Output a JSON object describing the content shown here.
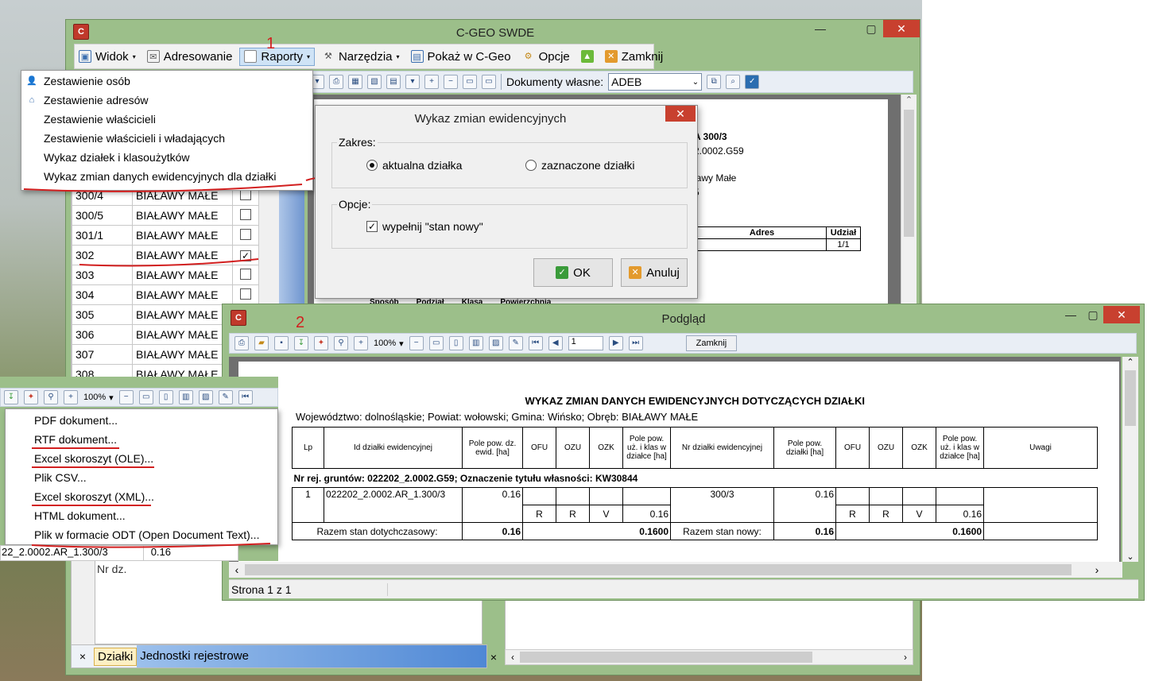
{
  "main_window": {
    "title": "C-GEO SWDE",
    "icon_text": "C",
    "menu": [
      {
        "label": "Widok"
      },
      {
        "label": "Adresowanie"
      },
      {
        "label": "Raporty"
      },
      {
        "label": "Narzędzia"
      },
      {
        "label": "Pokaż w C-Geo"
      },
      {
        "label": "Opcje"
      },
      {
        "label": "Zamknij"
      }
    ],
    "toolbar": {
      "own_docs_label": "Dokumenty własne:",
      "own_docs_value": "ADEB"
    },
    "annotation_1": "1",
    "annotation_2": "2"
  },
  "raporty_menu": {
    "items": [
      {
        "label": "Zestawienie osób"
      },
      {
        "label": "Zestawienie adresów"
      },
      {
        "label": "Zestawienie właścicieli"
      },
      {
        "label": "Zestawienie właścicieli i władających"
      },
      {
        "label": "Wykaz działek i klasoużytków"
      },
      {
        "label": "Wykaz zmian danych ewidencyjnych dla działki"
      }
    ]
  },
  "parcel_list": {
    "rows": [
      {
        "id": "300/4",
        "obreb": "BIAŁAWY MAŁE",
        "checked": false
      },
      {
        "id": "300/5",
        "obreb": "BIAŁAWY MAŁE",
        "checked": false
      },
      {
        "id": "301/1",
        "obreb": "BIAŁAWY MAŁE",
        "checked": false
      },
      {
        "id": "302",
        "obreb": "BIAŁAWY MAŁE",
        "checked": true
      },
      {
        "id": "303",
        "obreb": "BIAŁAWY MAŁE",
        "checked": false
      },
      {
        "id": "304",
        "obreb": "BIAŁAWY MAŁE",
        "checked": false
      },
      {
        "id": "305",
        "obreb": "BIAŁAWY MAŁE",
        "checked": false
      },
      {
        "id": "306",
        "obreb": "BIAŁAWY MAŁE",
        "checked": false
      },
      {
        "id": "307",
        "obreb": "BIAŁAWY MAŁE",
        "checked": false
      },
      {
        "id": "308",
        "obreb": "BIAŁAWY MAŁE",
        "checked": false
      }
    ],
    "lower_cell_1": "22_2.0002.AR_1.300/3",
    "lower_cell_2": "0.16",
    "nr_dz_label": "Nr dz.",
    "tabs": [
      {
        "label": "Działki"
      },
      {
        "label": "Jednostki rejestrowe"
      }
    ],
    "close_glyph": "×"
  },
  "bg_doc": {
    "line1": "A 300/3",
    "line2": "2.0002.G59",
    "line3": "ławy Małe",
    "line4": "5",
    "col_adres": "Adres",
    "col_udzial": "Udział",
    "udzial_val": "1/1",
    "bottom_cols": [
      "Sposób",
      "Podział",
      "Klasa",
      "Powierzchnia"
    ]
  },
  "dialog": {
    "title": "Wykaz zmian ewidencyjnych",
    "zakres_label": "Zakres:",
    "opt_current": "aktualna działka",
    "opt_selected": "zaznaczone działki",
    "opcje_label": "Opcje:",
    "checkbox_label": "wypełnij \"stan nowy\"",
    "ok_label": "OK",
    "cancel_label": "Anuluj"
  },
  "preview": {
    "title": "Podgląd",
    "zoom": "100%",
    "page": "1",
    "close_label": "Zamknij",
    "status": "Strona 1 z 1",
    "report": {
      "title": "WYKAZ ZMIAN DANYCH EWIDENCYJNYCH DOTYCZĄCYCH DZIAŁKI",
      "subtitle": "Województwo: dolnośląskie; Powiat: wołowski; Gmina: Wińsko; Obręb: BIAŁAWY MAŁE",
      "headers": [
        "Lp",
        "Id działki ewidencyjnej",
        "Pole pow. dz. ewid. [ha]",
        "OFU",
        "OZU",
        "OZK",
        "Pole pow. uż. i klas w działce [ha]",
        "Nr działki ewidencyjnej",
        "Pole pow. działki [ha]",
        "OFU",
        "OZU",
        "OZK",
        "Pole pow. uż. i klas w działce [ha]",
        "Uwagi"
      ],
      "group_line": "Nr rej. gruntów: 022202_2.0002.G59;   Oznaczenie tytułu własności: KW30844",
      "row": {
        "lp": "1",
        "id": "022202_2.0002.AR_1.300/3",
        "area": "0.16",
        "ofu": "R",
        "ozu": "R",
        "ozk": "V",
        "area_klas": "0.16",
        "nr": "300/3",
        "new_area": "0.16",
        "new_ofu": "R",
        "new_ozu": "R",
        "new_ozk": "V",
        "new_area_klas": "0.16"
      },
      "total_old_label": "Razem stan dotychczasowy:",
      "total_old_area": "0.16",
      "total_old_klas": "0.1600",
      "total_new_label": "Razem stan nowy:",
      "total_new_area": "0.16",
      "total_new_klas": "0.1600"
    }
  },
  "export_menu": {
    "zoom": "100%",
    "items": [
      {
        "label": "PDF dokument..."
      },
      {
        "label": "RTF dokument..."
      },
      {
        "label": "Excel skoroszyt (OLE)..."
      },
      {
        "label": "Plik CSV..."
      },
      {
        "label": "Excel skoroszyt (XML)..."
      },
      {
        "label": "HTML dokument..."
      },
      {
        "label": "Plik w formacie ODT (Open Document Text)..."
      }
    ]
  },
  "colors": {
    "accent": "#9cbf8a",
    "close": "#c8402f",
    "annotation": "#d21f1f"
  }
}
